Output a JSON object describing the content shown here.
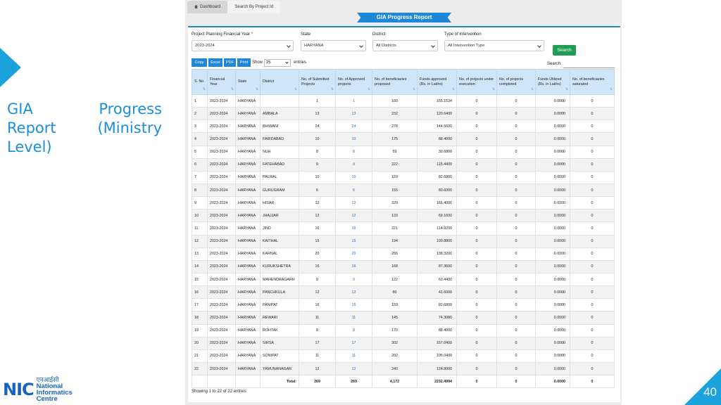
{
  "slide": {
    "title_line1_word1": "GIA",
    "title_line1_word2": "Progress",
    "title_line2_word1": "Report",
    "title_line2_word2": "(Ministry",
    "title_line3": "Level)",
    "page_number": "40",
    "logo_mark": "NIC",
    "logo_hindi": "एनआईसी",
    "logo_line1": "National",
    "logo_line2": "Informatics",
    "logo_line3": "Centre"
  },
  "tabs": [
    {
      "label": "Dashboard"
    },
    {
      "label": "Search By Project Id"
    }
  ],
  "report_title": "GIA Progress Report",
  "filters": {
    "year_label": "Project Planning Financial Year",
    "year_required": "*",
    "year_value": "2023-2024",
    "state_label": "State",
    "state_value": "HARYANA",
    "district_label": "District",
    "district_value": "All Districts",
    "intervention_label": "Type of Intervention",
    "intervention_value": "All Intervention Type",
    "search_button": "Search"
  },
  "toolbar": {
    "copy": "Copy",
    "excel": "Excel",
    "pdf": "PDF",
    "print": "Print",
    "show_label": "Show",
    "page_length": "25",
    "entries_label": "entries",
    "search_label": "Search:"
  },
  "columns": [
    "S. No.",
    "Financial Year",
    "State",
    "District",
    "No. of Submitted Projects",
    "No. of Approved projects",
    "No. of beneficiaries proposed",
    "Funds approved (Rs. in Lakhs)",
    "No. of projects under execution",
    "No. of projects completed",
    "Funds Utilized (Rs. in Lakhs)",
    "No. of beneficiaries saturated"
  ],
  "rows": [
    [
      "1",
      "2023-2024",
      "HARYANA",
      "",
      "1",
      "1",
      "160",
      "155.1534",
      "0",
      "0",
      "0.0000",
      "0"
    ],
    [
      "2",
      "2023-2024",
      "HARYANA",
      "AMBALA",
      "13",
      "13",
      "232",
      "120.6400",
      "0",
      "0",
      "0.0000",
      "0"
    ],
    [
      "3",
      "2023-2024",
      "HARYANA",
      "BHIWANI",
      "24",
      "24",
      "278",
      "144.5600",
      "0",
      "0",
      "0.0000",
      "0"
    ],
    [
      "4",
      "2023-2024",
      "HARYANA",
      "FARIDABAD",
      "10",
      "10",
      "175",
      "88.4000",
      "0",
      "0",
      "0.0000",
      "0"
    ],
    [
      "5",
      "2023-2024",
      "HARYANA",
      "NUH",
      "8",
      "8",
      "59",
      "30.6800",
      "0",
      "0",
      "0.0000",
      "0"
    ],
    [
      "6",
      "2023-2024",
      "HARYANA",
      "FATEHABAD",
      "9",
      "9",
      "222",
      "115.4400",
      "0",
      "0",
      "0.0000",
      "0"
    ],
    [
      "7",
      "2023-2024",
      "HARYANA",
      "PALWAL",
      "10",
      "10",
      "159",
      "82.6800",
      "0",
      "0",
      "0.0000",
      "0"
    ],
    [
      "8",
      "2023-2024",
      "HARYANA",
      "GURUGRAM",
      "6",
      "6",
      "155",
      "80.6000",
      "0",
      "0",
      "0.0000",
      "0"
    ],
    [
      "9",
      "2023-2024",
      "HARYANA",
      "HISAR",
      "12",
      "12",
      "320",
      "166.4000",
      "0",
      "0",
      "0.0000",
      "0"
    ],
    [
      "10",
      "2023-2024",
      "HARYANA",
      "JHAJJAR",
      "12",
      "12",
      "133",
      "69.1600",
      "0",
      "0",
      "0.0000",
      "0"
    ],
    [
      "11",
      "2023-2024",
      "HARYANA",
      "JIND",
      "16",
      "16",
      "221",
      "114.9200",
      "0",
      "0",
      "0.0000",
      "0"
    ],
    [
      "12",
      "2023-2024",
      "HARYANA",
      "KAITHAL",
      "15",
      "15",
      "194",
      "100.8800",
      "0",
      "0",
      "0.0000",
      "0"
    ],
    [
      "13",
      "2023-2024",
      "HARYANA",
      "KARNAL",
      "20",
      "20",
      "266",
      "138.3200",
      "0",
      "0",
      "0.0000",
      "0"
    ],
    [
      "14",
      "2023-2024",
      "HARYANA",
      "KURUKSHETRA",
      "16",
      "16",
      "168",
      "87.3600",
      "0",
      "0",
      "0.0000",
      "0"
    ],
    [
      "15",
      "2023-2024",
      "HARYANA",
      "MAHENDRAGARH",
      "9",
      "9",
      "122",
      "63.4400",
      "0",
      "0",
      "0.0000",
      "0"
    ],
    [
      "16",
      "2023-2024",
      "HARYANA",
      "PANCHKULA",
      "12",
      "12",
      "80",
      "41.6000",
      "0",
      "0",
      "0.0000",
      "0"
    ],
    [
      "17",
      "2023-2024",
      "HARYANA",
      "PANIPAT",
      "16",
      "16",
      "159",
      "82.6800",
      "0",
      "0",
      "0.0000",
      "0"
    ],
    [
      "18",
      "2023-2024",
      "HARYANA",
      "REWARI",
      "11",
      "11",
      "145",
      "74.3080",
      "0",
      "0",
      "0.0000",
      "0"
    ],
    [
      "19",
      "2023-2024",
      "HARYANA",
      "ROHTAK",
      "8",
      "8",
      "170",
      "88.4000",
      "0",
      "0",
      "0.0000",
      "0"
    ],
    [
      "20",
      "2023-2024",
      "HARYANA",
      "SIRSA",
      "17",
      "17",
      "302",
      "157.0400",
      "0",
      "0",
      "0.0000",
      "0"
    ],
    [
      "21",
      "2023-2024",
      "HARYANA",
      "SONIPAT",
      "11",
      "11",
      "202",
      "105.0400",
      "0",
      "0",
      "0.0000",
      "0"
    ],
    [
      "22",
      "2023-2024",
      "HARYANA",
      "YAMUNANAGAR",
      "12",
      "12",
      "240",
      "124.8000",
      "0",
      "0",
      "0.0000",
      "0"
    ]
  ],
  "totals": {
    "label": "Total:",
    "submitted": "269",
    "approved": "269",
    "beneficiaries": "4,172",
    "funds_approved": "2232.4994",
    "under_execution": "0",
    "completed": "0",
    "funds_utilized": "0.0000",
    "saturated": "0"
  },
  "footer_info": "Showing 1 to 22 of 22 entries",
  "colors": {
    "accent": "#1ba1dc",
    "primary_button": "#1e88d6",
    "search_button": "#1f9d55",
    "link": "#1e6fc0"
  }
}
